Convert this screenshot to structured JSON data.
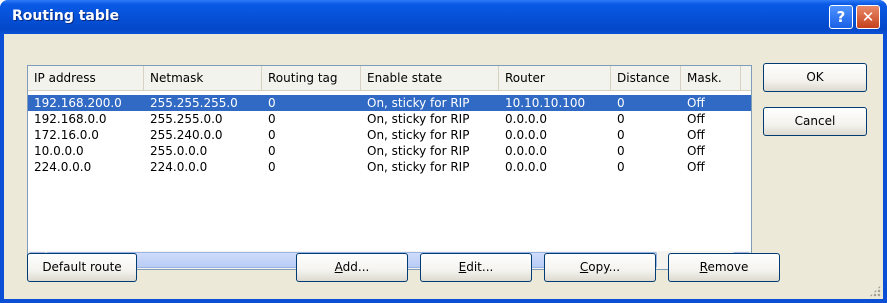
{
  "window": {
    "title": "Routing table",
    "help_glyph": "?",
    "close_glyph": "✕"
  },
  "table": {
    "columns": [
      "IP address",
      "Netmask",
      "Routing tag",
      "Enable state",
      "Router",
      "Distance",
      "Mask."
    ],
    "rows": [
      [
        "192.168.200.0",
        "255.255.255.0",
        "0",
        "On, sticky for RIP",
        "10.10.10.100",
        "0",
        "Off"
      ],
      [
        "192.168.0.0",
        "255.255.0.0",
        "0",
        "On, sticky for RIP",
        "0.0.0.0",
        "0",
        "Off"
      ],
      [
        "172.16.0.0",
        "255.240.0.0",
        "0",
        "On, sticky for RIP",
        "0.0.0.0",
        "0",
        "Off"
      ],
      [
        "10.0.0.0",
        "255.0.0.0",
        "0",
        "On, sticky for RIP",
        "0.0.0.0",
        "0",
        "Off"
      ],
      [
        "224.0.0.0",
        "224.0.0.0",
        "0",
        "On, sticky for RIP",
        "0.0.0.0",
        "0",
        "Off"
      ]
    ],
    "selected_row": 0
  },
  "scrollbar": {
    "left_arrow": "<",
    "right_arrow": ">",
    "thumb_grip": "III"
  },
  "buttons": {
    "default_route": "Default route",
    "add": {
      "mnemonic": "A",
      "rest": "dd..."
    },
    "edit": {
      "mnemonic": "E",
      "rest": "dit..."
    },
    "copy": {
      "mnemonic": "C",
      "rest": "opy..."
    },
    "remove": {
      "mnemonic": "R",
      "rest": "emove"
    },
    "ok": "OK",
    "cancel": "Cancel"
  },
  "colors": {
    "title_bar": "#0a52d4",
    "dialog_face": "#ece9d8",
    "selection": "#316ac5",
    "list_border": "#7f9db9"
  }
}
